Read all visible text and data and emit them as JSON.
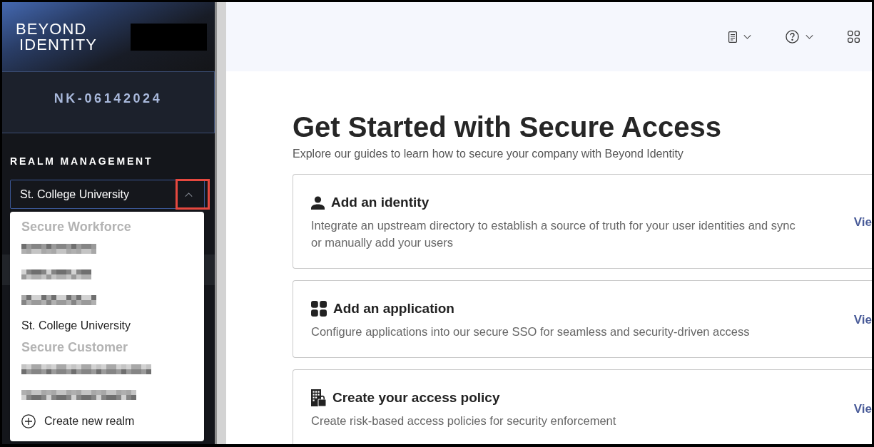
{
  "sidebar": {
    "logo": {
      "lines": [
        "BEYOND",
        "IDENTITY"
      ]
    },
    "redacted_block": true,
    "tenant": "NK-06142024",
    "section_title": "REALM MANAGEMENT",
    "realm_select": {
      "value": "St. College University",
      "expanded": true,
      "toggle_highlighted": true
    },
    "realm_menu": {
      "groups": [
        {
          "label": "Secure Workforce",
          "items": [
            {
              "kind": "redacted"
            },
            {
              "kind": "redacted"
            },
            {
              "kind": "redacted"
            },
            {
              "kind": "realm",
              "label": "St. College University"
            }
          ]
        },
        {
          "label": "Secure Customer",
          "items": [
            {
              "kind": "redacted"
            },
            {
              "kind": "redacted"
            }
          ]
        }
      ],
      "create_action": {
        "label": "Create new realm"
      }
    }
  },
  "top_bar": {
    "icons": [
      {
        "kind": "document",
        "has_menu": true
      },
      {
        "kind": "help",
        "has_menu": true
      },
      {
        "kind": "apps",
        "has_menu": false
      }
    ]
  },
  "main": {
    "title": "Get Started with Secure Access",
    "subtitle": "Explore our guides to learn how to secure your company with Beyond Identity",
    "cards": [
      {
        "kind": "identity",
        "title": "Add an identity",
        "description": "Integrate an upstream directory to establish a source of truth for your user identities and sync or manually add your users",
        "link": "Vie"
      },
      {
        "kind": "application",
        "title": "Add an application",
        "description": "Configure applications into our secure SSO for seamless and security-driven access",
        "link": "Vie"
      },
      {
        "kind": "policy",
        "title": "Create your access policy",
        "description": "Create risk-based access policies for security enforcement",
        "link": "Vie"
      }
    ]
  }
}
